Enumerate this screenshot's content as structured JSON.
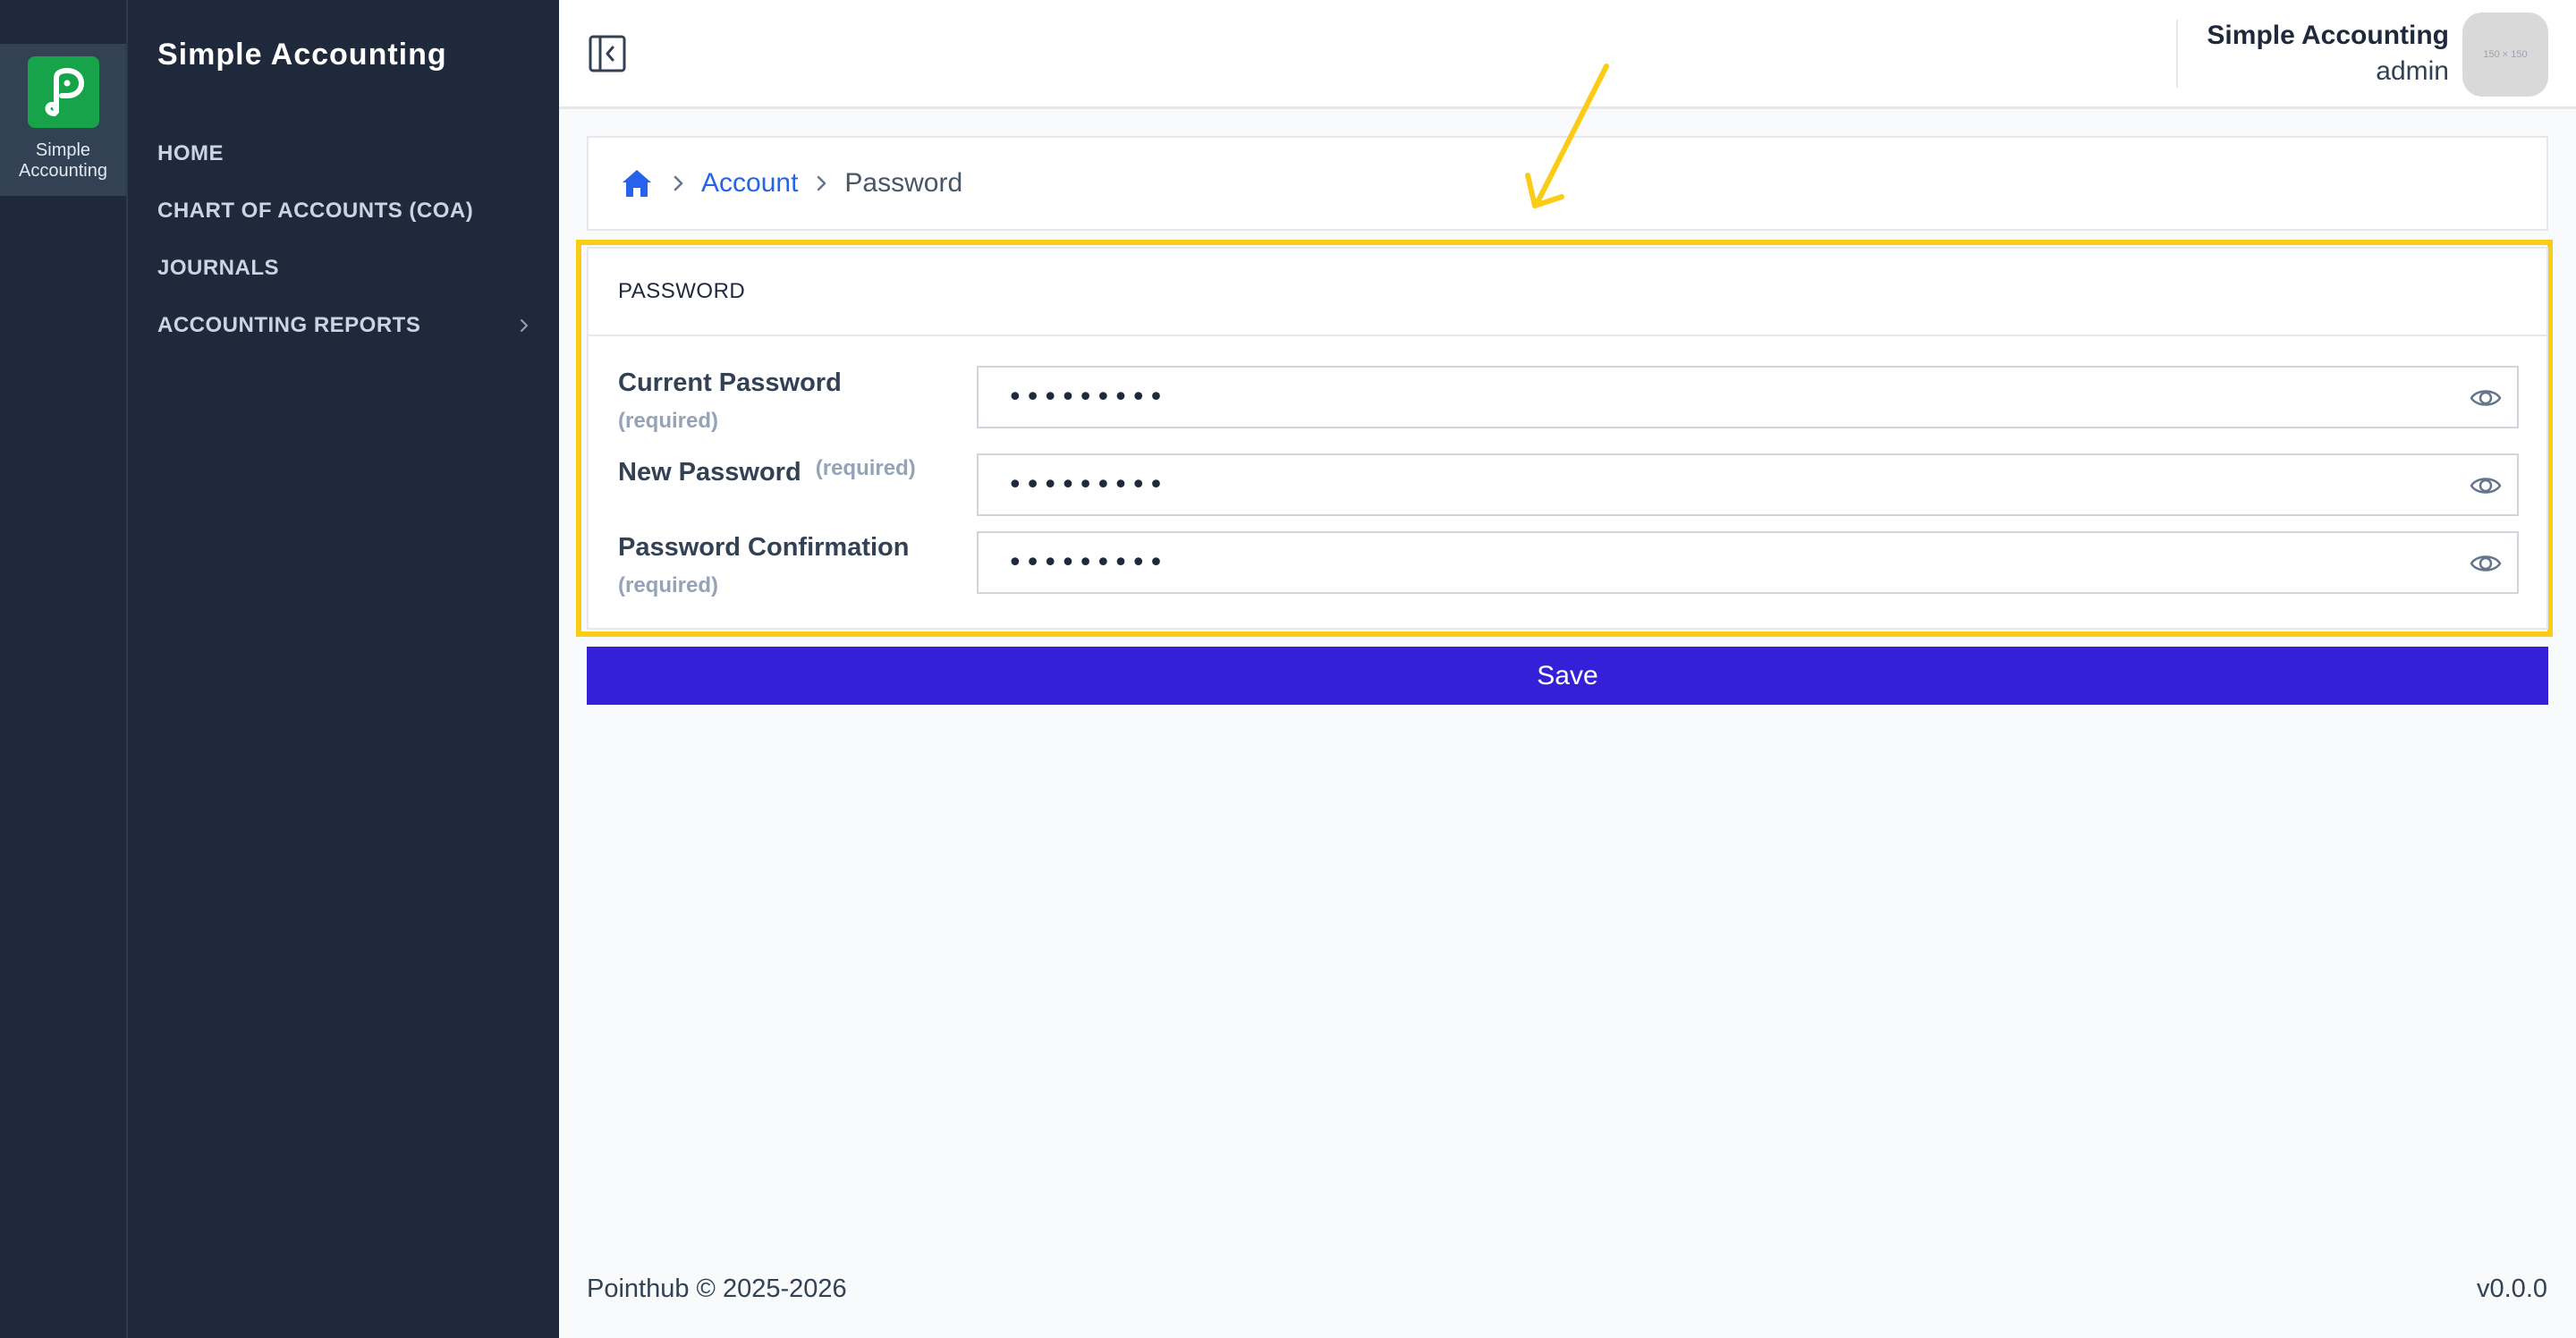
{
  "rail": {
    "app_label": "Simple Accounting",
    "logo_icon": "p-logo-icon"
  },
  "sidebar": {
    "title": "Simple Accounting",
    "items": [
      {
        "label": "HOME"
      },
      {
        "label": "CHART OF ACCOUNTS (COA)"
      },
      {
        "label": "JOURNALS"
      },
      {
        "label": "ACCOUNTING REPORTS",
        "has_submenu": true
      }
    ]
  },
  "header": {
    "app_name": "Simple Accounting",
    "user_role": "admin",
    "avatar_placeholder": "150 × 150"
  },
  "breadcrumb": {
    "items": [
      "Account"
    ],
    "current": "Password"
  },
  "form": {
    "title": "PASSWORD",
    "required_label": "(required)",
    "fields": [
      {
        "label": "Current Password",
        "value": "•••••••••"
      },
      {
        "label": "New Password",
        "value": "•••••••••"
      },
      {
        "label": "Password Confirmation",
        "value": "•••••••••"
      }
    ],
    "save_label": "Save"
  },
  "footer": {
    "copyright": "Pointhub © 2025-2026",
    "version": "v0.0.0"
  },
  "colors": {
    "sidebar_bg": "#1e293b",
    "accent": "#3420d9",
    "highlight": "#facc15",
    "logo": "#16a34a",
    "link": "#2563eb"
  }
}
